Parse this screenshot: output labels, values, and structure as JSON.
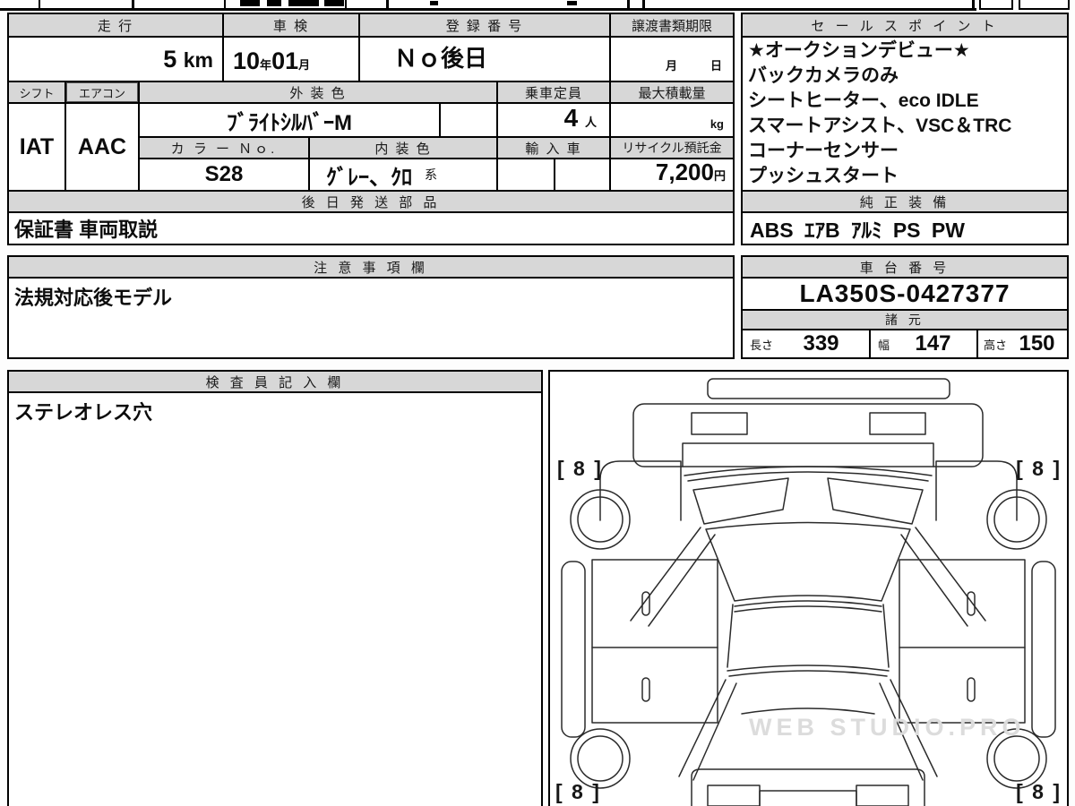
{
  "colors": {
    "header_bg": "#d7d7d7",
    "grid": "#000000",
    "paper": "#ffffff"
  },
  "top_table": {
    "mileage": {
      "label": "走 行",
      "value": "5",
      "unit": "km"
    },
    "inspection": {
      "label": "車 検",
      "year": "10",
      "year_unit": "年",
      "month": "01",
      "month_unit": "月"
    },
    "registration": {
      "label": "登 録 番 号",
      "value": "Ｎｏ後日"
    },
    "transfer_docs": {
      "label": "譲渡書類期限",
      "month_unit": "月",
      "day_unit": "日"
    },
    "shift": {
      "label": "シフト",
      "value": "IAT"
    },
    "aircon": {
      "label": "エアコン",
      "value": "AAC"
    },
    "exterior_color": {
      "label": "外 装 色",
      "value": "ﾌﾞﾗｲﾄｼﾙﾊﾞｰM"
    },
    "capacity": {
      "label": "乗車定員",
      "value": "4",
      "unit": "人"
    },
    "max_load": {
      "label": "最大積載量",
      "unit": "kg"
    },
    "color_no": {
      "label": "カ ラ ー Ｎｏ.",
      "value": "S28"
    },
    "interior_color": {
      "label": "内 装 色",
      "value": "ｸﾞﾚｰ、ｸﾛ",
      "suffix": "系"
    },
    "import_car": {
      "label": "輸 入 車"
    },
    "recycle_fee": {
      "label": "リサイクル預託金",
      "value": "7,200",
      "unit": "円"
    },
    "later_shipping": {
      "label": "後 日 発 送 部 品",
      "value": "保証書 車両取説"
    }
  },
  "sales_point": {
    "label": "セ ー ル ス ポ イ ン ト",
    "lines": [
      "★オークションデビュー★",
      "バックカメラのみ",
      "シートヒーター、eco IDLE",
      "スマートアシスト、VSC＆TRC",
      "コーナーセンサー",
      "プッシュスタート"
    ]
  },
  "genuine_equipment": {
    "label": "純 正 装 備",
    "value": "ABS ｴｱB ｱﾙﾐ PS PW"
  },
  "notes": {
    "label": "注 意 事 項 欄",
    "value": "法規対応後モデル"
  },
  "chassis_no": {
    "label": "車 台 番 号",
    "value": "LA350S-0427377"
  },
  "specs": {
    "label": "諸 元",
    "length": {
      "label": "長さ",
      "value": "339"
    },
    "width": {
      "label": "幅",
      "value": "147"
    },
    "height": {
      "label": "高さ",
      "value": "150"
    }
  },
  "inspector_notes": {
    "label": "検 査 員 記 入 欄",
    "value": "ステレオレス穴"
  },
  "diagram": {
    "tire_mark_front_left": "[ 8 ]",
    "tire_mark_front_right": "[ 8 ]",
    "tire_mark_rear_left": "[ 8 ]",
    "tire_mark_rear_right": "[ 8 ]",
    "watermark": "WEB STUDIO.PRO"
  }
}
